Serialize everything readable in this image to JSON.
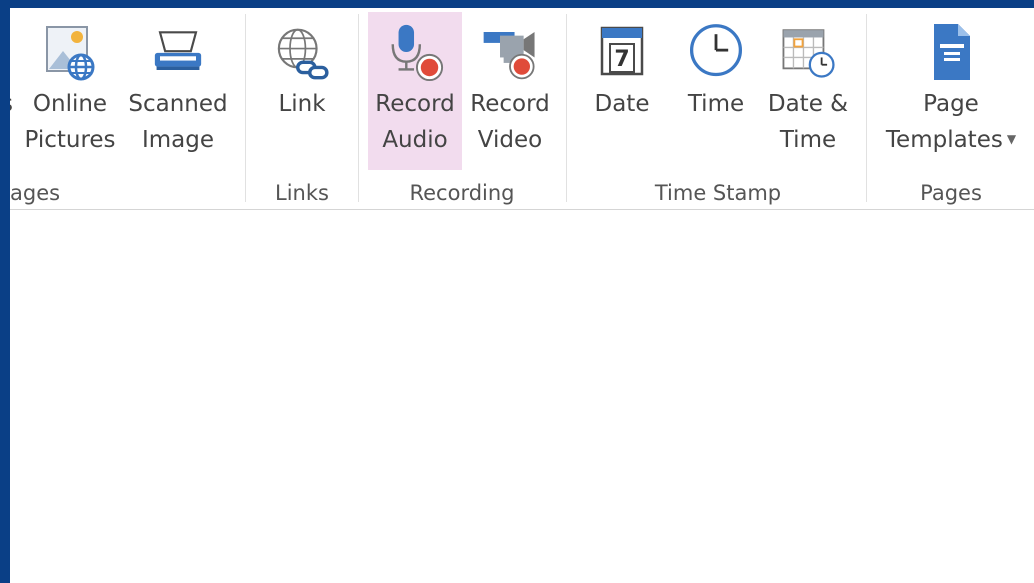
{
  "ribbon": {
    "groups": [
      {
        "label": "ages"
      },
      {
        "label": "Links"
      },
      {
        "label": "Recording"
      },
      {
        "label": "Time Stamp"
      },
      {
        "label": "Pages"
      }
    ],
    "buttons": {
      "partial_left": {
        "line1": "s"
      },
      "online_pictures": {
        "line1": "Online",
        "line2": "Pictures",
        "icon": "online-pictures-icon"
      },
      "scanned_image": {
        "line1": "Scanned",
        "line2": "Image",
        "icon": "scanner-icon"
      },
      "link": {
        "line1": "Link",
        "icon": "link-icon"
      },
      "record_audio": {
        "line1": "Record",
        "line2": "Audio",
        "icon": "microphone-record-icon"
      },
      "record_video": {
        "line1": "Record",
        "line2": "Video",
        "icon": "video-record-icon"
      },
      "date": {
        "line1": "Date",
        "icon": "calendar-icon",
        "calendar_number": "7"
      },
      "time": {
        "line1": "Time",
        "icon": "clock-icon"
      },
      "date_time": {
        "line1": "Date &",
        "line2": "Time",
        "icon": "calendar-clock-icon"
      },
      "page_templates": {
        "line1": "Page",
        "line2": "Templates",
        "icon": "page-template-icon"
      }
    }
  },
  "colors": {
    "frame": "#0a3f86",
    "active_button": "#f2dcee",
    "icon_blue": "#3b78c4",
    "record_red": "#e04b3a"
  }
}
